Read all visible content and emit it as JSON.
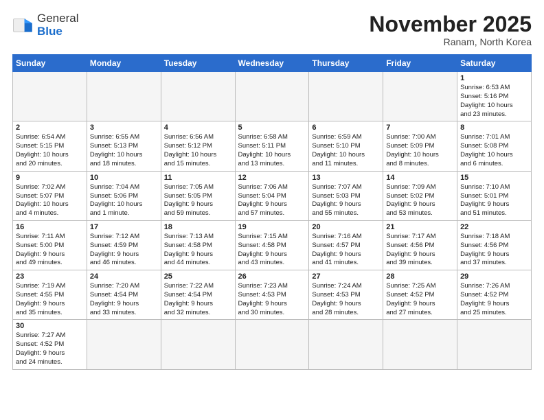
{
  "header": {
    "logo_general": "General",
    "logo_blue": "Blue",
    "month_title": "November 2025",
    "location": "Ranam, North Korea"
  },
  "weekdays": [
    "Sunday",
    "Monday",
    "Tuesday",
    "Wednesday",
    "Thursday",
    "Friday",
    "Saturday"
  ],
  "weeks": [
    [
      {
        "day": "",
        "info": ""
      },
      {
        "day": "",
        "info": ""
      },
      {
        "day": "",
        "info": ""
      },
      {
        "day": "",
        "info": ""
      },
      {
        "day": "",
        "info": ""
      },
      {
        "day": "",
        "info": ""
      },
      {
        "day": "1",
        "info": "Sunrise: 6:53 AM\nSunset: 5:16 PM\nDaylight: 10 hours\nand 23 minutes."
      }
    ],
    [
      {
        "day": "2",
        "info": "Sunrise: 6:54 AM\nSunset: 5:15 PM\nDaylight: 10 hours\nand 20 minutes."
      },
      {
        "day": "3",
        "info": "Sunrise: 6:55 AM\nSunset: 5:13 PM\nDaylight: 10 hours\nand 18 minutes."
      },
      {
        "day": "4",
        "info": "Sunrise: 6:56 AM\nSunset: 5:12 PM\nDaylight: 10 hours\nand 15 minutes."
      },
      {
        "day": "5",
        "info": "Sunrise: 6:58 AM\nSunset: 5:11 PM\nDaylight: 10 hours\nand 13 minutes."
      },
      {
        "day": "6",
        "info": "Sunrise: 6:59 AM\nSunset: 5:10 PM\nDaylight: 10 hours\nand 11 minutes."
      },
      {
        "day": "7",
        "info": "Sunrise: 7:00 AM\nSunset: 5:09 PM\nDaylight: 10 hours\nand 8 minutes."
      },
      {
        "day": "8",
        "info": "Sunrise: 7:01 AM\nSunset: 5:08 PM\nDaylight: 10 hours\nand 6 minutes."
      }
    ],
    [
      {
        "day": "9",
        "info": "Sunrise: 7:02 AM\nSunset: 5:07 PM\nDaylight: 10 hours\nand 4 minutes."
      },
      {
        "day": "10",
        "info": "Sunrise: 7:04 AM\nSunset: 5:06 PM\nDaylight: 10 hours\nand 1 minute."
      },
      {
        "day": "11",
        "info": "Sunrise: 7:05 AM\nSunset: 5:05 PM\nDaylight: 9 hours\nand 59 minutes."
      },
      {
        "day": "12",
        "info": "Sunrise: 7:06 AM\nSunset: 5:04 PM\nDaylight: 9 hours\nand 57 minutes."
      },
      {
        "day": "13",
        "info": "Sunrise: 7:07 AM\nSunset: 5:03 PM\nDaylight: 9 hours\nand 55 minutes."
      },
      {
        "day": "14",
        "info": "Sunrise: 7:09 AM\nSunset: 5:02 PM\nDaylight: 9 hours\nand 53 minutes."
      },
      {
        "day": "15",
        "info": "Sunrise: 7:10 AM\nSunset: 5:01 PM\nDaylight: 9 hours\nand 51 minutes."
      }
    ],
    [
      {
        "day": "16",
        "info": "Sunrise: 7:11 AM\nSunset: 5:00 PM\nDaylight: 9 hours\nand 49 minutes."
      },
      {
        "day": "17",
        "info": "Sunrise: 7:12 AM\nSunset: 4:59 PM\nDaylight: 9 hours\nand 46 minutes."
      },
      {
        "day": "18",
        "info": "Sunrise: 7:13 AM\nSunset: 4:58 PM\nDaylight: 9 hours\nand 44 minutes."
      },
      {
        "day": "19",
        "info": "Sunrise: 7:15 AM\nSunset: 4:58 PM\nDaylight: 9 hours\nand 43 minutes."
      },
      {
        "day": "20",
        "info": "Sunrise: 7:16 AM\nSunset: 4:57 PM\nDaylight: 9 hours\nand 41 minutes."
      },
      {
        "day": "21",
        "info": "Sunrise: 7:17 AM\nSunset: 4:56 PM\nDaylight: 9 hours\nand 39 minutes."
      },
      {
        "day": "22",
        "info": "Sunrise: 7:18 AM\nSunset: 4:56 PM\nDaylight: 9 hours\nand 37 minutes."
      }
    ],
    [
      {
        "day": "23",
        "info": "Sunrise: 7:19 AM\nSunset: 4:55 PM\nDaylight: 9 hours\nand 35 minutes."
      },
      {
        "day": "24",
        "info": "Sunrise: 7:20 AM\nSunset: 4:54 PM\nDaylight: 9 hours\nand 33 minutes."
      },
      {
        "day": "25",
        "info": "Sunrise: 7:22 AM\nSunset: 4:54 PM\nDaylight: 9 hours\nand 32 minutes."
      },
      {
        "day": "26",
        "info": "Sunrise: 7:23 AM\nSunset: 4:53 PM\nDaylight: 9 hours\nand 30 minutes."
      },
      {
        "day": "27",
        "info": "Sunrise: 7:24 AM\nSunset: 4:53 PM\nDaylight: 9 hours\nand 28 minutes."
      },
      {
        "day": "28",
        "info": "Sunrise: 7:25 AM\nSunset: 4:52 PM\nDaylight: 9 hours\nand 27 minutes."
      },
      {
        "day": "29",
        "info": "Sunrise: 7:26 AM\nSunset: 4:52 PM\nDaylight: 9 hours\nand 25 minutes."
      }
    ],
    [
      {
        "day": "30",
        "info": "Sunrise: 7:27 AM\nSunset: 4:52 PM\nDaylight: 9 hours\nand 24 minutes."
      },
      {
        "day": "",
        "info": ""
      },
      {
        "day": "",
        "info": ""
      },
      {
        "day": "",
        "info": ""
      },
      {
        "day": "",
        "info": ""
      },
      {
        "day": "",
        "info": ""
      },
      {
        "day": "",
        "info": ""
      }
    ]
  ]
}
